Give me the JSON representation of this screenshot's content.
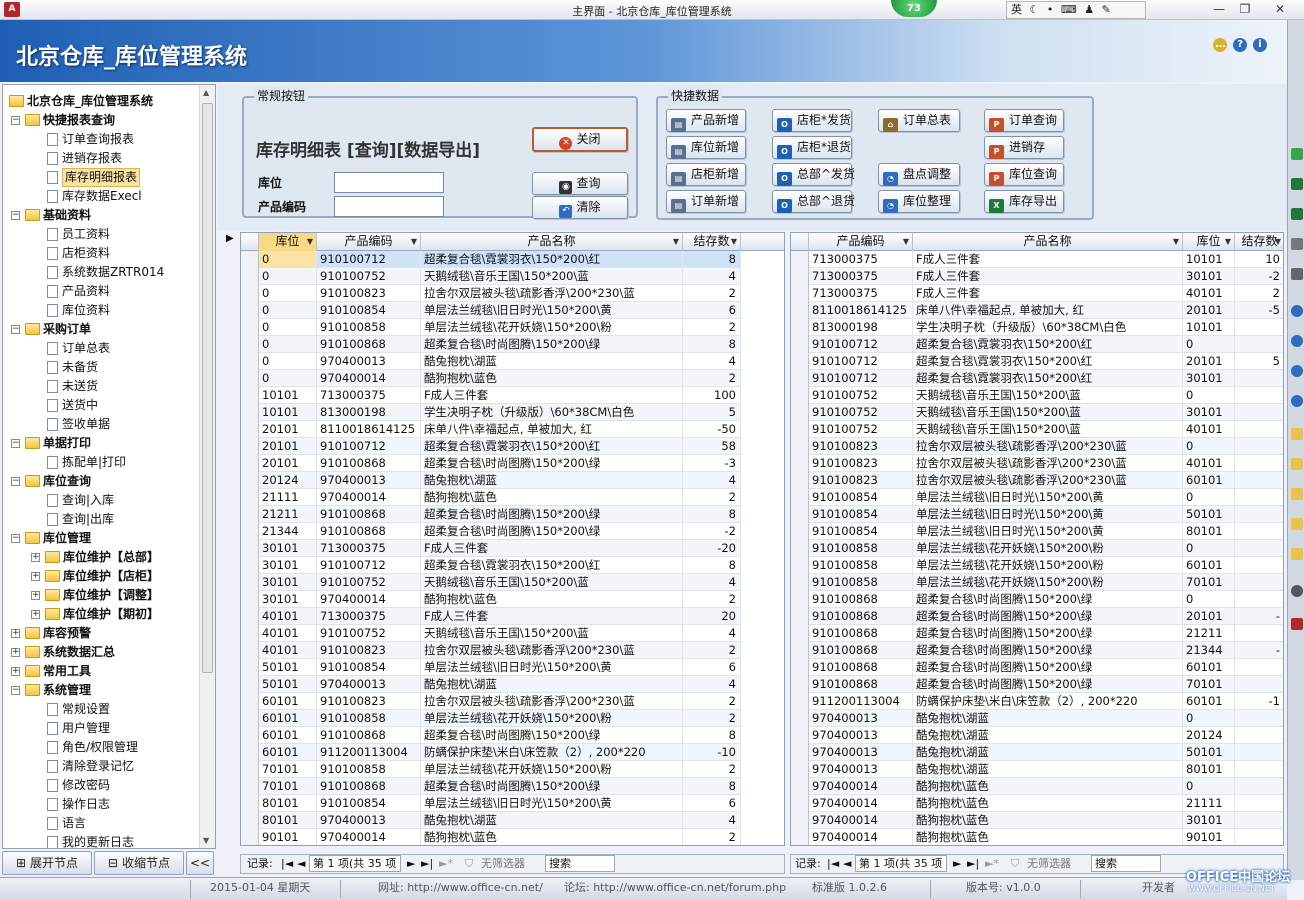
{
  "window": {
    "title": "主界面 - 北京仓库_库位管理系统",
    "badge": "73",
    "ime": "英",
    "app_icon": "A"
  },
  "header": {
    "title": "北京仓库_库位管理系统"
  },
  "tree": [
    {
      "label": "北京仓库_库位管理系统",
      "level": 0,
      "type": "root",
      "bold": true
    },
    {
      "label": "快捷报表查询",
      "level": 1,
      "type": "folder",
      "bold": true
    },
    {
      "label": "订单查询报表",
      "level": 2,
      "type": "doc"
    },
    {
      "label": "进销存报表",
      "level": 2,
      "type": "doc"
    },
    {
      "label": "库存明细报表",
      "level": 2,
      "type": "doc",
      "selected": true
    },
    {
      "label": "库存数据Execl",
      "level": 2,
      "type": "doc"
    },
    {
      "label": "基础资料",
      "level": 1,
      "type": "folder",
      "bold": true
    },
    {
      "label": "员工资料",
      "level": 2,
      "type": "doc"
    },
    {
      "label": "店柜资料",
      "level": 2,
      "type": "doc"
    },
    {
      "label": "系统数据ZRTR014",
      "level": 2,
      "type": "doc"
    },
    {
      "label": "产品资料",
      "level": 2,
      "type": "doc"
    },
    {
      "label": "库位资料",
      "level": 2,
      "type": "doc"
    },
    {
      "label": "采购订单",
      "level": 1,
      "type": "folder",
      "bold": true
    },
    {
      "label": "订单总表",
      "level": 2,
      "type": "doc"
    },
    {
      "label": "未备货",
      "level": 2,
      "type": "doc"
    },
    {
      "label": "未送货",
      "level": 2,
      "type": "doc"
    },
    {
      "label": "送货中",
      "level": 2,
      "type": "doc"
    },
    {
      "label": "签收单据",
      "level": 2,
      "type": "doc"
    },
    {
      "label": "单据打印",
      "level": 1,
      "type": "folder",
      "bold": true
    },
    {
      "label": "拣配单|打印",
      "level": 2,
      "type": "doc"
    },
    {
      "label": "库位查询",
      "level": 1,
      "type": "folder",
      "bold": true
    },
    {
      "label": "查询|入库",
      "level": 2,
      "type": "doc"
    },
    {
      "label": "查询|出库",
      "level": 2,
      "type": "doc"
    },
    {
      "label": "库位管理",
      "level": 1,
      "type": "folder",
      "bold": true
    },
    {
      "label": "库位维护【总部】",
      "level": 2,
      "type": "folder",
      "bold": true,
      "collapsed": true
    },
    {
      "label": "库位维护【店柜】",
      "level": 2,
      "type": "folder",
      "bold": true,
      "collapsed": true
    },
    {
      "label": "库位维护【调整】",
      "level": 2,
      "type": "folder",
      "bold": true,
      "collapsed": true
    },
    {
      "label": "库位维护【期初】",
      "level": 2,
      "type": "folder",
      "bold": true,
      "collapsed": true
    },
    {
      "label": "库容预警",
      "level": 1,
      "type": "folder",
      "bold": true,
      "collapsed": true
    },
    {
      "label": "系统数据汇总",
      "level": 1,
      "type": "folder",
      "bold": true,
      "collapsed": true
    },
    {
      "label": "常用工具",
      "level": 1,
      "type": "folder",
      "bold": true,
      "collapsed": true
    },
    {
      "label": "系统管理",
      "level": 1,
      "type": "folder",
      "bold": true
    },
    {
      "label": "常规设置",
      "level": 2,
      "type": "doc"
    },
    {
      "label": "用户管理",
      "level": 2,
      "type": "doc"
    },
    {
      "label": "角色/权限管理",
      "level": 2,
      "type": "doc"
    },
    {
      "label": "清除登录记忆",
      "level": 2,
      "type": "doc"
    },
    {
      "label": "修改密码",
      "level": 2,
      "type": "doc"
    },
    {
      "label": "操作日志",
      "level": 2,
      "type": "doc"
    },
    {
      "label": "语言",
      "level": 2,
      "type": "doc"
    },
    {
      "label": "我的更新日志",
      "level": 2,
      "type": "doc"
    }
  ],
  "sidebar_buttons": {
    "expand": "展开节点",
    "collapse": "收缩节点",
    "toggle": "<<"
  },
  "normal_group": {
    "label": "常规按钮",
    "title": "库存明细表 [查询][数据导出]",
    "location_label": "库位",
    "product_label": "产品编码",
    "close": "关闭",
    "query": "查询",
    "clear": "清除"
  },
  "quick_group": {
    "label": "快捷数据",
    "buttons": [
      {
        "label": "产品新增",
        "icon": "form-icon",
        "color": "#5a6f8f",
        "col": 0,
        "row": 0
      },
      {
        "label": "店柜*发货",
        "icon": "outlook-icon",
        "color": "#1f5fb4",
        "col": 1,
        "row": 0
      },
      {
        "label": "订单总表",
        "icon": "home-icon",
        "color": "#8c6a2d",
        "col": 2,
        "row": 0
      },
      {
        "label": "订单查询",
        "icon": "powerpoint-icon",
        "color": "#c4502a",
        "col": 3,
        "row": 0
      },
      {
        "label": "库位新增",
        "icon": "form-icon",
        "color": "#5a6f8f",
        "col": 0,
        "row": 1
      },
      {
        "label": "店柜*退货",
        "icon": "outlook-icon",
        "color": "#1f5fb4",
        "col": 1,
        "row": 1
      },
      {
        "label": "进销存",
        "icon": "powerpoint-icon",
        "color": "#c4502a",
        "col": 3,
        "row": 1
      },
      {
        "label": "店柜新增",
        "icon": "form-icon",
        "color": "#5a6f8f",
        "col": 0,
        "row": 2
      },
      {
        "label": "总部^发货",
        "icon": "outlook-icon",
        "color": "#1f5fb4",
        "col": 1,
        "row": 2
      },
      {
        "label": "盘点调整",
        "icon": "pie-icon",
        "color": "#2f6bbf",
        "col": 2,
        "row": 2
      },
      {
        "label": "库位查询",
        "icon": "powerpoint-icon",
        "color": "#c4502a",
        "col": 3,
        "row": 2
      },
      {
        "label": "订单新增",
        "icon": "form-icon",
        "color": "#5a6f8f",
        "col": 0,
        "row": 3
      },
      {
        "label": "总部^退货",
        "icon": "outlook-icon",
        "color": "#1f5fb4",
        "col": 1,
        "row": 3
      },
      {
        "label": "库位整理",
        "icon": "pie-icon",
        "color": "#2f6bbf",
        "col": 2,
        "row": 3
      },
      {
        "label": "库存导出",
        "icon": "excel-icon",
        "color": "#1e7a3c",
        "col": 3,
        "row": 3
      }
    ]
  },
  "left_grid": {
    "columns": [
      "库位",
      "产品编码",
      "产品名称",
      "结存数"
    ],
    "rows": [
      [
        "0",
        "910100712",
        "超柔复合毯\\霓裳羽衣\\150*200\\红",
        "8"
      ],
      [
        "0",
        "910100752",
        "天鹅绒毯\\音乐王国\\150*200\\蓝",
        "4"
      ],
      [
        "0",
        "910100823",
        "拉舍尔双层被头毯\\疏影香浮\\200*230\\蓝",
        "2"
      ],
      [
        "0",
        "910100854",
        "单层法兰绒毯\\旧日时光\\150*200\\黄",
        "6"
      ],
      [
        "0",
        "910100858",
        "单层法兰绒毯\\花开妖娆\\150*200\\粉",
        "2"
      ],
      [
        "0",
        "910100868",
        "超柔复合毯\\时尚图腾\\150*200\\绿",
        "8"
      ],
      [
        "0",
        "970400013",
        "酷兔抱枕\\湖蓝",
        "4"
      ],
      [
        "0",
        "970400014",
        "酷狗抱枕\\蓝色",
        "2"
      ],
      [
        "10101",
        "713000375",
        "F成人三件套",
        "100"
      ],
      [
        "10101",
        "813000198",
        "学生决明子枕（升级版）\\60*38CM\\白色",
        "5"
      ],
      [
        "20101",
        "8110018614125",
        "床单八件\\幸福起点, 单被加大, 红",
        "-50"
      ],
      [
        "20101",
        "910100712",
        "超柔复合毯\\霓裳羽衣\\150*200\\红",
        "58"
      ],
      [
        "20101",
        "910100868",
        "超柔复合毯\\时尚图腾\\150*200\\绿",
        "-3"
      ],
      [
        "20124",
        "970400013",
        "酷兔抱枕\\湖蓝",
        "4"
      ],
      [
        "21111",
        "970400014",
        "酷狗抱枕\\蓝色",
        "2"
      ],
      [
        "21211",
        "910100868",
        "超柔复合毯\\时尚图腾\\150*200\\绿",
        "8"
      ],
      [
        "21344",
        "910100868",
        "超柔复合毯\\时尚图腾\\150*200\\绿",
        "-2"
      ],
      [
        "30101",
        "713000375",
        "F成人三件套",
        "-20"
      ],
      [
        "30101",
        "910100712",
        "超柔复合毯\\霓裳羽衣\\150*200\\红",
        "8"
      ],
      [
        "30101",
        "910100752",
        "天鹅绒毯\\音乐王国\\150*200\\蓝",
        "4"
      ],
      [
        "30101",
        "970400014",
        "酷狗抱枕\\蓝色",
        "2"
      ],
      [
        "40101",
        "713000375",
        "F成人三件套",
        "20"
      ],
      [
        "40101",
        "910100752",
        "天鹅绒毯\\音乐王国\\150*200\\蓝",
        "4"
      ],
      [
        "40101",
        "910100823",
        "拉舍尔双层被头毯\\疏影香浮\\200*230\\蓝",
        "2"
      ],
      [
        "50101",
        "910100854",
        "单层法兰绒毯\\旧日时光\\150*200\\黄",
        "6"
      ],
      [
        "50101",
        "970400013",
        "酷兔抱枕\\湖蓝",
        "4"
      ],
      [
        "60101",
        "910100823",
        "拉舍尔双层被头毯\\疏影香浮\\200*230\\蓝",
        "2"
      ],
      [
        "60101",
        "910100858",
        "单层法兰绒毯\\花开妖娆\\150*200\\粉",
        "2"
      ],
      [
        "60101",
        "910100868",
        "超柔复合毯\\时尚图腾\\150*200\\绿",
        "8"
      ],
      [
        "60101",
        "911200113004",
        "防螨保护床垫\\米白\\床笠款（2）, 200*220",
        "-10"
      ],
      [
        "70101",
        "910100858",
        "单层法兰绒毯\\花开妖娆\\150*200\\粉",
        "2"
      ],
      [
        "70101",
        "910100868",
        "超柔复合毯\\时尚图腾\\150*200\\绿",
        "8"
      ],
      [
        "80101",
        "910100854",
        "单层法兰绒毯\\旧日时光\\150*200\\黄",
        "6"
      ],
      [
        "80101",
        "970400013",
        "酷兔抱枕\\湖蓝",
        "4"
      ],
      [
        "90101",
        "970400014",
        "酷狗抱枕\\蓝色",
        "2"
      ]
    ]
  },
  "right_grid": {
    "columns": [
      "产品编码",
      "产品名称",
      "库位",
      "结存数"
    ],
    "rows": [
      [
        "713000375",
        "F成人三件套",
        "10101",
        "10"
      ],
      [
        "713000375",
        "F成人三件套",
        "30101",
        "-2"
      ],
      [
        "713000375",
        "F成人三件套",
        "40101",
        "2"
      ],
      [
        "8110018614125",
        "床单八件\\幸福起点, 单被加大, 红",
        "20101",
        "-5"
      ],
      [
        "813000198",
        "学生决明子枕（升级版）\\60*38CM\\白色",
        "10101",
        ""
      ],
      [
        "910100712",
        "超柔复合毯\\霓裳羽衣\\150*200\\红",
        "0",
        ""
      ],
      [
        "910100712",
        "超柔复合毯\\霓裳羽衣\\150*200\\红",
        "20101",
        "5"
      ],
      [
        "910100712",
        "超柔复合毯\\霓裳羽衣\\150*200\\红",
        "30101",
        ""
      ],
      [
        "910100752",
        "天鹅绒毯\\音乐王国\\150*200\\蓝",
        "0",
        ""
      ],
      [
        "910100752",
        "天鹅绒毯\\音乐王国\\150*200\\蓝",
        "30101",
        ""
      ],
      [
        "910100752",
        "天鹅绒毯\\音乐王国\\150*200\\蓝",
        "40101",
        ""
      ],
      [
        "910100823",
        "拉舍尔双层被头毯\\疏影香浮\\200*230\\蓝",
        "0",
        ""
      ],
      [
        "910100823",
        "拉舍尔双层被头毯\\疏影香浮\\200*230\\蓝",
        "40101",
        ""
      ],
      [
        "910100823",
        "拉舍尔双层被头毯\\疏影香浮\\200*230\\蓝",
        "60101",
        ""
      ],
      [
        "910100854",
        "单层法兰绒毯\\旧日时光\\150*200\\黄",
        "0",
        ""
      ],
      [
        "910100854",
        "单层法兰绒毯\\旧日时光\\150*200\\黄",
        "50101",
        ""
      ],
      [
        "910100854",
        "单层法兰绒毯\\旧日时光\\150*200\\黄",
        "80101",
        ""
      ],
      [
        "910100858",
        "单层法兰绒毯\\花开妖娆\\150*200\\粉",
        "0",
        ""
      ],
      [
        "910100858",
        "单层法兰绒毯\\花开妖娆\\150*200\\粉",
        "60101",
        ""
      ],
      [
        "910100858",
        "单层法兰绒毯\\花开妖娆\\150*200\\粉",
        "70101",
        ""
      ],
      [
        "910100868",
        "超柔复合毯\\时尚图腾\\150*200\\绿",
        "0",
        ""
      ],
      [
        "910100868",
        "超柔复合毯\\时尚图腾\\150*200\\绿",
        "20101",
        "-"
      ],
      [
        "910100868",
        "超柔复合毯\\时尚图腾\\150*200\\绿",
        "21211",
        ""
      ],
      [
        "910100868",
        "超柔复合毯\\时尚图腾\\150*200\\绿",
        "21344",
        "-"
      ],
      [
        "910100868",
        "超柔复合毯\\时尚图腾\\150*200\\绿",
        "60101",
        ""
      ],
      [
        "910100868",
        "超柔复合毯\\时尚图腾\\150*200\\绿",
        "70101",
        ""
      ],
      [
        "911200113004",
        "防螨保护床垫\\米白\\床笠款（2）, 200*220",
        "60101",
        "-1"
      ],
      [
        "970400013",
        "酷兔抱枕\\湖蓝",
        "0",
        ""
      ],
      [
        "970400013",
        "酷兔抱枕\\湖蓝",
        "20124",
        ""
      ],
      [
        "970400013",
        "酷兔抱枕\\湖蓝",
        "50101",
        ""
      ],
      [
        "970400013",
        "酷兔抱枕\\湖蓝",
        "80101",
        ""
      ],
      [
        "970400014",
        "酷狗抱枕\\蓝色",
        "0",
        ""
      ],
      [
        "970400014",
        "酷狗抱枕\\蓝色",
        "21111",
        ""
      ],
      [
        "970400014",
        "酷狗抱枕\\蓝色",
        "30101",
        ""
      ],
      [
        "970400014",
        "酷狗抱枕\\蓝色",
        "90101",
        ""
      ]
    ]
  },
  "nav": {
    "records_label": "记录:",
    "first": "|◄",
    "prev": "◄",
    "position": "第 1 项(共 35 项",
    "next": "►",
    "last": "►|",
    "new": "►*",
    "no_filter": "无筛选器",
    "search": "搜索"
  },
  "status": {
    "date": "2015-01-04 星期天",
    "url": "网址: http://www.office-cn.net/",
    "forum": "论坛: http://www.office-cn.net/forum.php",
    "edition": "标准版 1.0.2.6",
    "version": "版本号: v1.0.0",
    "developer": "开发者"
  },
  "watermark": {
    "main": "OFFICE中国论坛",
    "sub": "WWW.OFFICE-CN.NET"
  },
  "colors": {
    "header_start": "#1f5fb4",
    "selection": "#fbe3a4",
    "current_row": "#cfe2f8",
    "close_border": "#bf5a2c"
  }
}
